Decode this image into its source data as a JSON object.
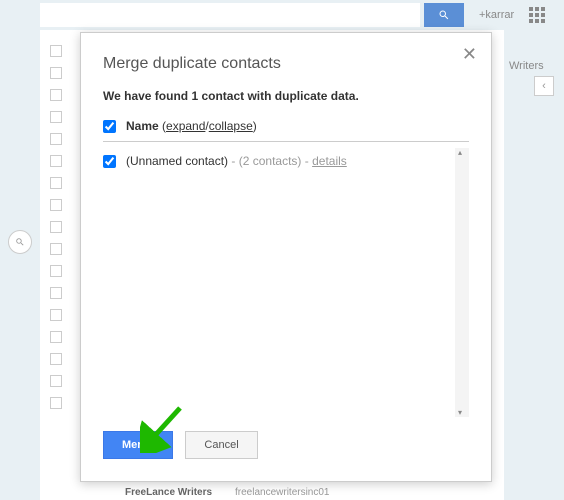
{
  "topbar": {
    "user": "+karrar"
  },
  "sidebar": {
    "group_label": "Writers"
  },
  "bottom": {
    "text1": "FreeLance Writers",
    "text2": "freelancewritersinc01"
  },
  "modal": {
    "title": "Merge duplicate contacts",
    "subtitle": "We have found 1 contact with duplicate data.",
    "header": {
      "name_label": "Name",
      "expand": "expand",
      "collapse": "collapse"
    },
    "contact": {
      "name": "(Unnamed contact)",
      "count": "(2 contacts)",
      "details": "details"
    },
    "buttons": {
      "merge": "Merge",
      "cancel": "Cancel"
    }
  }
}
